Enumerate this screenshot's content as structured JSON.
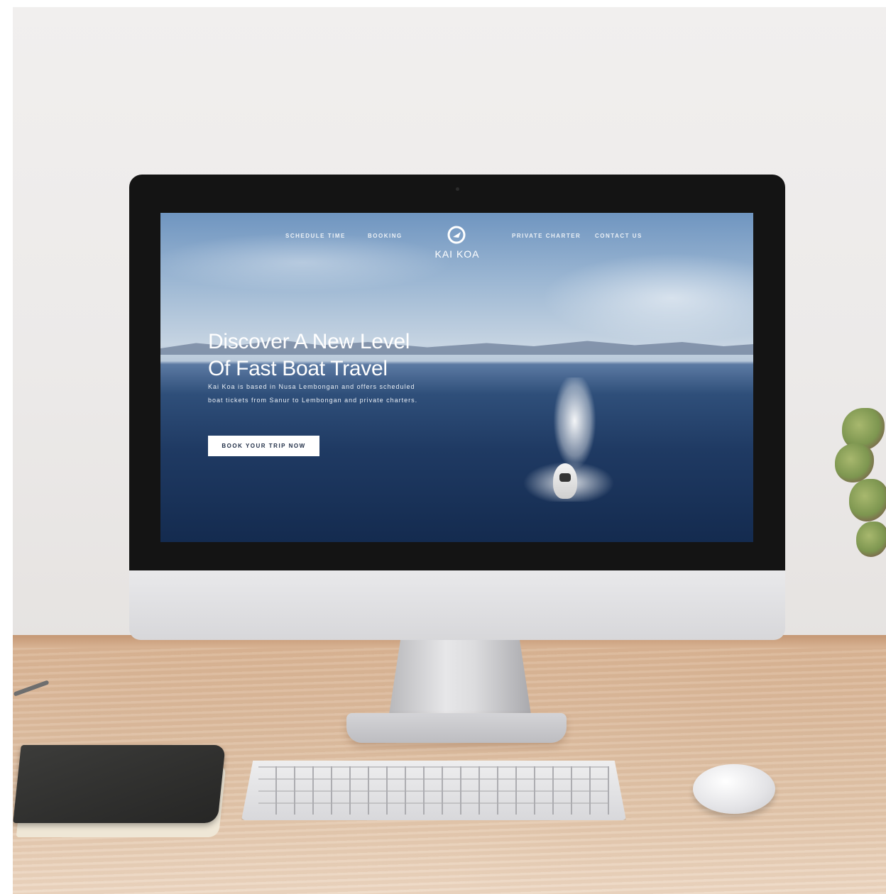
{
  "site": {
    "nav": {
      "items": [
        {
          "label": "SCHEDULE TIME"
        },
        {
          "label": "BOOKING"
        },
        {
          "label": "PRIVATE CHARTER"
        },
        {
          "label": "CONTACT US"
        }
      ],
      "logo_text": "KAI KOA",
      "logo_icon": "boat-logo-icon"
    },
    "hero": {
      "headline_line1": "Discover A New Level",
      "headline_line2": "Of Fast Boat Travel",
      "description": "Kai Koa is based in Nusa Lembongan and offers scheduled boat tickets from Sanur to Lembongan and private charters.",
      "cta_label": "BOOK YOUR TRIP NOW"
    }
  },
  "colors": {
    "cta_background": "#ffffff",
    "cta_text": "#1d2b44",
    "sea": "#1f3a63"
  }
}
